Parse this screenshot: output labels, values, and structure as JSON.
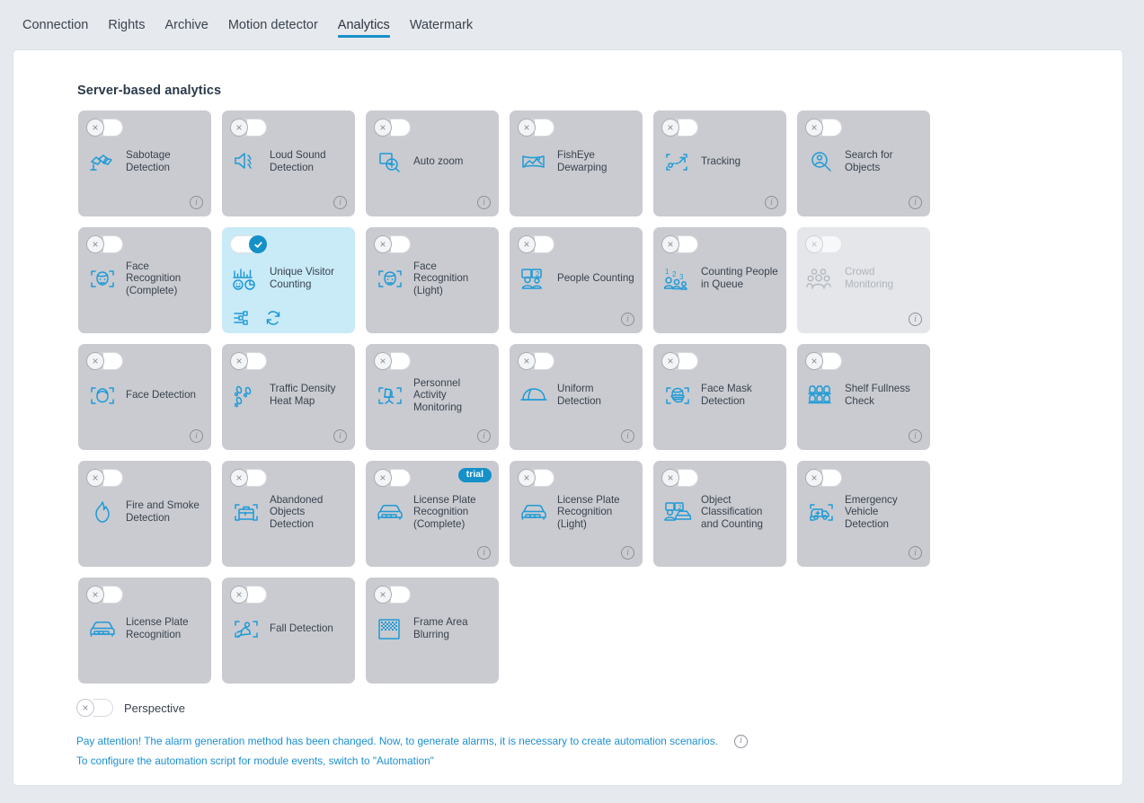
{
  "tabs": [
    {
      "label": "Connection",
      "active": false
    },
    {
      "label": "Rights",
      "active": false
    },
    {
      "label": "Archive",
      "active": false
    },
    {
      "label": "Motion detector",
      "active": false
    },
    {
      "label": "Analytics",
      "active": true
    },
    {
      "label": "Watermark",
      "active": false
    }
  ],
  "section": {
    "title": "Server-based analytics"
  },
  "colors": {
    "accent": "#1590c8",
    "card_bg": "#c9cbd0",
    "card_active_bg": "#c9eaf7",
    "card_disabled_bg": "#e4e6ea",
    "icon_blue": "#1f9ad6",
    "page_bg": "#e6e9ed",
    "panel_bg": "#ffffff",
    "label_text": "#39424e",
    "note_text": "#1a8fd0"
  },
  "cards": [
    {
      "label": "Sabotage Detection",
      "icon": "sabotage-icon",
      "toggle": "off",
      "state": "normal",
      "info": true,
      "trial": false
    },
    {
      "label": "Loud Sound Detection",
      "icon": "loud-sound-icon",
      "toggle": "off",
      "state": "normal",
      "info": true,
      "trial": false
    },
    {
      "label": "Auto zoom",
      "icon": "auto-zoom-icon",
      "toggle": "off",
      "state": "normal",
      "info": true,
      "trial": false
    },
    {
      "label": "FishEye Dewarping",
      "icon": "fisheye-dewarping-icon",
      "toggle": "off",
      "state": "normal",
      "info": false,
      "trial": false
    },
    {
      "label": "Tracking",
      "icon": "tracking-icon",
      "toggle": "off",
      "state": "normal",
      "info": true,
      "trial": false
    },
    {
      "label": "Search for Objects",
      "icon": "search-objects-icon",
      "toggle": "off",
      "state": "normal",
      "info": true,
      "trial": false
    },
    {
      "label": "Face Recognition (Complete)",
      "icon": "face-recognition-icon",
      "toggle": "off",
      "state": "normal",
      "info": false,
      "trial": false
    },
    {
      "label": "Unique Visitor Counting",
      "icon": "unique-visitor-counting-icon",
      "toggle": "on",
      "state": "active",
      "info": false,
      "trial": false,
      "actions": [
        "settings-icon",
        "refresh-icon"
      ]
    },
    {
      "label": "Face Recognition (Light)",
      "icon": "face-recognition-icon",
      "toggle": "off",
      "state": "normal",
      "info": false,
      "trial": false
    },
    {
      "label": "People Counting",
      "icon": "people-counting-icon",
      "toggle": "off",
      "state": "normal",
      "info": true,
      "trial": false
    },
    {
      "label": "Counting People in Queue",
      "icon": "counting-queue-icon",
      "toggle": "off",
      "state": "normal",
      "info": false,
      "trial": false
    },
    {
      "label": "Crowd Monitoring",
      "icon": "crowd-monitoring-icon",
      "toggle": "off",
      "state": "disabled",
      "info": true,
      "trial": false
    },
    {
      "label": "Face Detection",
      "icon": "face-detection-icon",
      "toggle": "off",
      "state": "normal",
      "info": true,
      "trial": false
    },
    {
      "label": "Traffic Density Heat Map",
      "icon": "heat-map-icon",
      "toggle": "off",
      "state": "normal",
      "info": true,
      "trial": false
    },
    {
      "label": "Personnel Activity Monitoring",
      "icon": "personnel-activity-icon",
      "toggle": "off",
      "state": "normal",
      "info": true,
      "trial": false
    },
    {
      "label": "Uniform Detection",
      "icon": "uniform-detection-icon",
      "toggle": "off",
      "state": "normal",
      "info": true,
      "trial": false
    },
    {
      "label": "Face Mask Detection",
      "icon": "face-mask-icon",
      "toggle": "off",
      "state": "normal",
      "info": false,
      "trial": false
    },
    {
      "label": "Shelf Fullness Check",
      "icon": "shelf-fullness-icon",
      "toggle": "off",
      "state": "normal",
      "info": true,
      "trial": false
    },
    {
      "label": "Fire and Smoke Detection",
      "icon": "fire-smoke-icon",
      "toggle": "off",
      "state": "normal",
      "info": false,
      "trial": false
    },
    {
      "label": "Abandoned Objects Detection",
      "icon": "abandoned-objects-icon",
      "toggle": "off",
      "state": "normal",
      "info": false,
      "trial": false
    },
    {
      "label": "License Plate Recognition (Complete)",
      "icon": "license-plate-icon",
      "toggle": "off",
      "state": "normal",
      "info": true,
      "trial": true,
      "trial_label": "trial"
    },
    {
      "label": "License Plate Recognition (Light)",
      "icon": "license-plate-icon",
      "toggle": "off",
      "state": "normal",
      "info": true,
      "trial": false
    },
    {
      "label": "Object Classification and Counting",
      "icon": "object-classification-icon",
      "toggle": "off",
      "state": "normal",
      "info": false,
      "trial": false
    },
    {
      "label": "Emergency Vehicle Detection",
      "icon": "emergency-vehicle-icon",
      "toggle": "off",
      "state": "normal",
      "info": true,
      "trial": false
    },
    {
      "label": "License Plate Recognition",
      "icon": "license-plate-icon",
      "toggle": "off",
      "state": "normal",
      "info": false,
      "trial": false
    },
    {
      "label": "Fall Detection",
      "icon": "fall-detection-icon",
      "toggle": "off",
      "state": "normal",
      "info": false,
      "trial": false
    },
    {
      "label": "Frame Area Blurring",
      "icon": "frame-blurring-icon",
      "toggle": "off",
      "state": "normal",
      "info": false,
      "trial": false
    }
  ],
  "perspective": {
    "label": "Perspective",
    "toggle": "off"
  },
  "notes": [
    {
      "text": "Pay attention! The alarm generation method has been changed. Now, to generate alarms, it is necessary to create automation scenarios.",
      "info": true
    },
    {
      "text": "To configure the automation script for module events, switch to \"Automation\"",
      "info": false
    }
  ]
}
